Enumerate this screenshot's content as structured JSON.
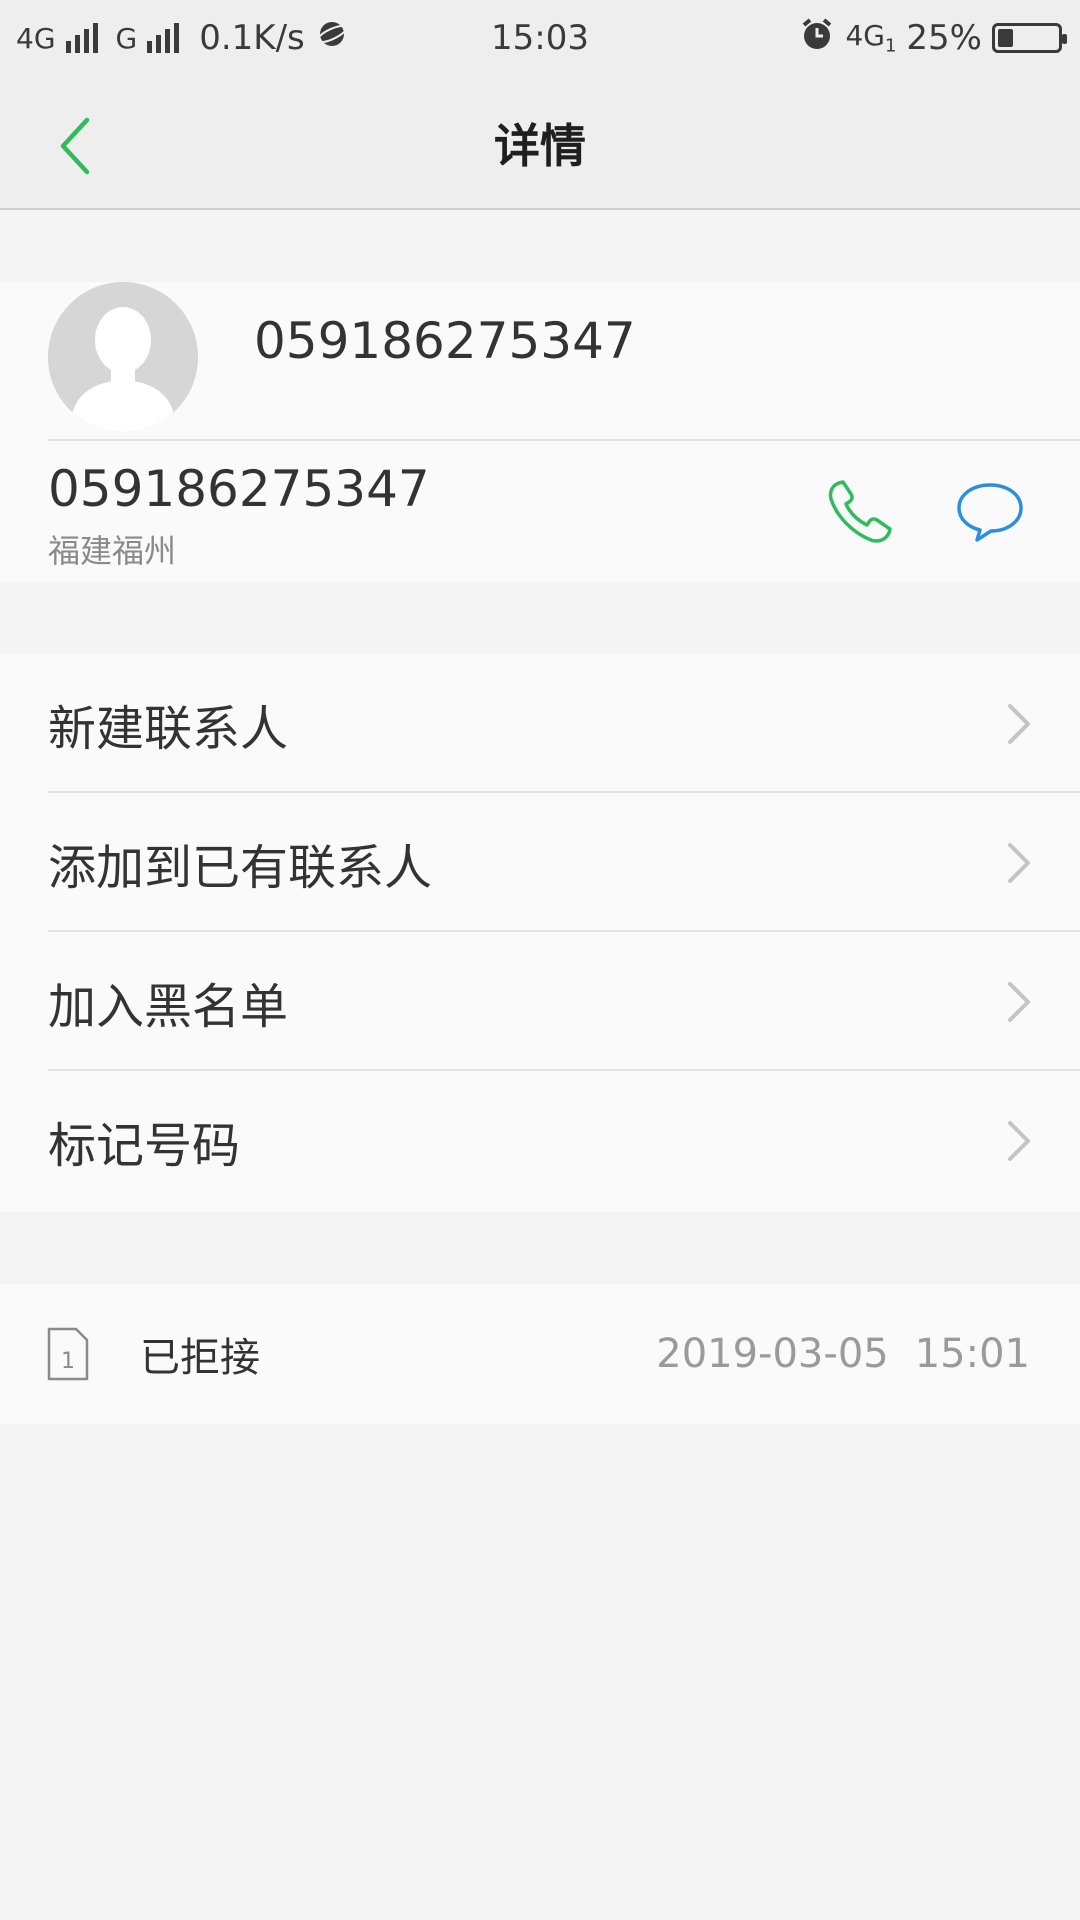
{
  "status_bar": {
    "network1": "4G",
    "network2": "G",
    "speed": "0.1K/s",
    "time": "15:03",
    "network3": "4G",
    "sim_index": "1",
    "battery_percent": "25%",
    "battery_level": 0.25,
    "icons": [
      "signal-icon",
      "planet-icon",
      "alarm-icon",
      "battery-icon"
    ]
  },
  "header": {
    "title": "详情",
    "back_icon": "chevron-left-icon",
    "accent_color": "#2ebd59"
  },
  "contact": {
    "name": "059186275347",
    "number": "059186275347",
    "location": "福建福州",
    "call_icon": "phone-icon",
    "message_icon": "message-icon",
    "call_color": "#2ebd59",
    "message_color": "#2b8fe0"
  },
  "actions": [
    {
      "label": "新建联系人"
    },
    {
      "label": "添加到已有联系人"
    },
    {
      "label": "加入黑名单"
    },
    {
      "label": "标记号码"
    }
  ],
  "call_log": {
    "sim_label": "1",
    "status": "已拒接",
    "date": "2019-03-05",
    "time": "15:01"
  }
}
